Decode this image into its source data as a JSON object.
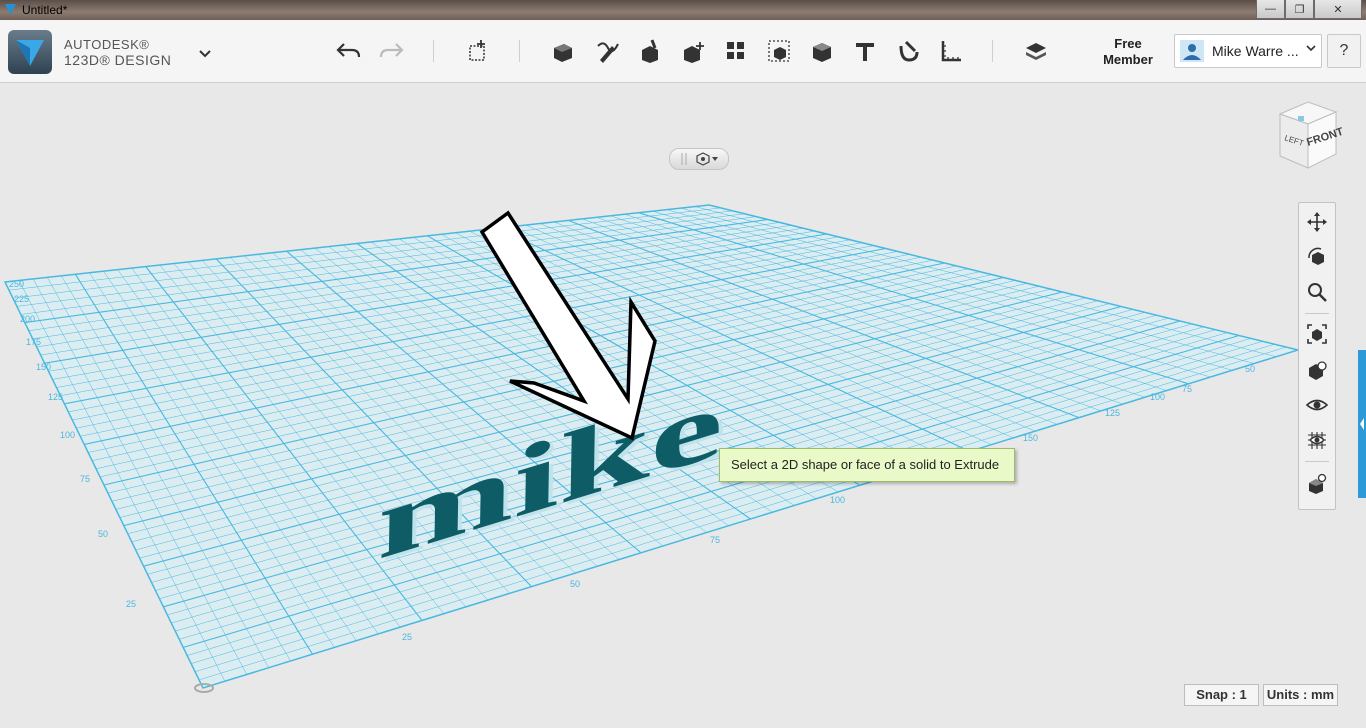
{
  "window": {
    "title": "Untitled*",
    "controls": {
      "minimize": "—",
      "maximize": "❐",
      "close": "✕"
    }
  },
  "brand": {
    "line1": "AUTODESK®",
    "line2": "123D® DESIGN"
  },
  "toolbar": {
    "tools": [
      {
        "name": "undo",
        "icon": "undo-icon"
      },
      {
        "name": "redo",
        "icon": "redo-icon"
      },
      {
        "name": "primitives",
        "icon": "primitives-icon"
      },
      {
        "name": "sketch",
        "icon": "sketch-icon"
      },
      {
        "name": "construct",
        "icon": "construct-icon"
      },
      {
        "name": "modify",
        "icon": "modify-icon"
      },
      {
        "name": "transform",
        "icon": "transform-icon"
      },
      {
        "name": "pattern",
        "icon": "pattern-icon"
      },
      {
        "name": "group",
        "icon": "group-icon"
      },
      {
        "name": "combine",
        "icon": "combine-icon"
      },
      {
        "name": "text",
        "icon": "text-icon"
      },
      {
        "name": "snap",
        "icon": "snap-icon"
      },
      {
        "name": "measure",
        "icon": "measure-icon"
      },
      {
        "name": "materials",
        "icon": "materials-icon"
      }
    ]
  },
  "account": {
    "membership": "Free Member",
    "membership_line1": "Free",
    "membership_line2": "Member",
    "user_name": "Mike Warre ...",
    "help_label": "?"
  },
  "viewcube": {
    "front": "FRONT",
    "left": "LEFT"
  },
  "scene": {
    "text_object": "mike",
    "grid_tick_labels_left": [
      "250",
      "225",
      "200",
      "175",
      "150",
      "125",
      "100",
      "75",
      "50",
      "25"
    ],
    "grid_tick_labels_bottom": [
      "25",
      "50",
      "75",
      "100"
    ],
    "grid_tick_labels_right": [
      "150",
      "125",
      "100",
      "75",
      "50"
    ]
  },
  "tooltip": {
    "text": "Select a 2D shape or face of a solid to Extrude"
  },
  "navbar": {
    "items": [
      "pan-icon",
      "orbit-icon",
      "zoom-icon",
      "fit-icon",
      "view-icon",
      "visibility-icon",
      "grid-material-icon",
      "outliner-icon"
    ]
  },
  "status": {
    "snap": "Snap : 1",
    "units": "Units : mm"
  },
  "colors": {
    "grid": "#49b8e0",
    "text_object": "#0e5c66",
    "accent": "#2b9ad6",
    "tooltip_bg": "#eaf9c8"
  }
}
